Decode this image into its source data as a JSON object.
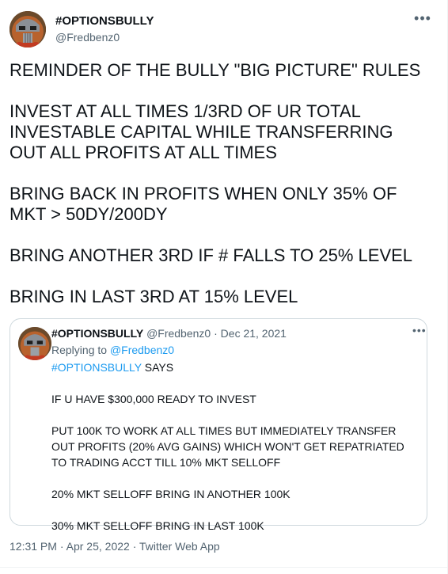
{
  "author": {
    "display_name": "#OPTIONSBULLY",
    "handle": "@Fredbenz0",
    "more_icon": "more-horizontal-icon"
  },
  "tweet": {
    "paragraphs": [
      "REMINDER OF THE BULLY \"BIG PICTURE\" RULES",
      "INVEST AT ALL TIMES 1/3RD OF UR TOTAL INVESTABLE CAPITAL WHILE TRANSFERRING OUT ALL PROFITS AT ALL TIMES",
      "BRING BACK IN PROFITS WHEN ONLY 35% OF MKT > 50DY/200DY",
      "BRING ANOTHER 3RD IF # FALLS TO 25% LEVEL",
      "BRING IN LAST 3RD AT 15% LEVEL"
    ]
  },
  "quoted": {
    "display_name": "#OPTIONSBULLY",
    "handle": "@Fredbenz0",
    "separator": "·",
    "date": "Dec 21, 2021",
    "replying_prefix": "Replying to",
    "replying_to": "@Fredbenz0",
    "hashtag": "#OPTIONSBULLY",
    "says": "SAYS",
    "paragraphs": [
      "IF U HAVE $300,000 READY TO INVEST",
      "PUT 100K TO WORK AT ALL TIMES BUT IMMEDIATELY TRANSFER OUT PROFITS (20% AVG GAINS) WHICH WON'T GET REPATRIATED TO TRADING ACCT TILL 10% MKT SELLOFF",
      "20% MKT SELLOFF BRING IN ANOTHER 100K",
      "30% MKT SELLOFF BRING IN LAST 100K"
    ]
  },
  "footer": {
    "time": "12:31 PM",
    "separator": "·",
    "date": "Apr 25, 2022",
    "source": "Twitter Web App"
  },
  "colors": {
    "text": "#0f1419",
    "secondary": "#536471",
    "link": "#1d9bf0",
    "border": "#cfd9de"
  }
}
